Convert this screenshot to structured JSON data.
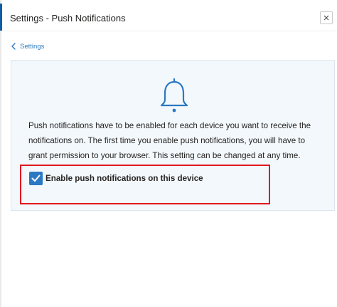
{
  "header": {
    "title": "Settings - Push Notifications",
    "close_icon": "close-icon"
  },
  "nav": {
    "back_label": "Settings",
    "back_icon": "chevron-left-icon"
  },
  "card": {
    "icon": "bell-icon",
    "description_lines": [
      "Push notifications have to be enabled for each device you want to receive the",
      "notifications on. The first time you enable push notifications, you will have to",
      "grant permission to your browser. This setting can be changed at any time."
    ],
    "checkbox": {
      "label": "Enable push notifications on this device",
      "checked": true
    }
  },
  "colors": {
    "accent": "#2b79c2",
    "header_accent": "#0f5ea6",
    "card_background": "#f3f8fc",
    "highlight_border": "#e0181f"
  }
}
